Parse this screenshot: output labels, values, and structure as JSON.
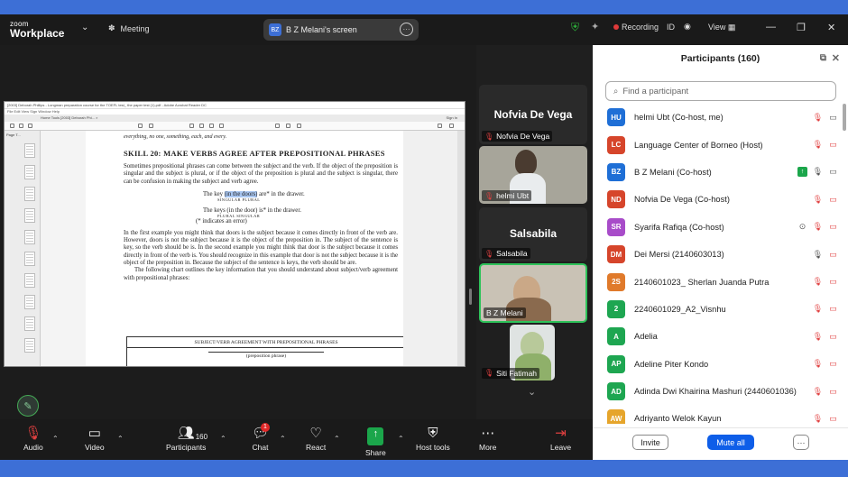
{
  "app": {
    "brand_line1": "zoom",
    "brand_line2": "Workplace",
    "meeting_label": "Meeting"
  },
  "screen_share": {
    "initials": "BZ",
    "label": "B Z Melani's screen"
  },
  "titlebar": {
    "recording_label": "Recording",
    "id_label": "ID",
    "view_label": "View"
  },
  "pdf": {
    "window_title": "[2003] Deborah Phillips - Longman preparation course for the TOEFL test_ the paper test (1).pdf - Adobe Acrobat Reader DC",
    "menu": "File   Edit   View   Sign   Window   Help",
    "tabs": "Home    Tools    [2003] Deborah Phi...  ×",
    "signin": "Sign In",
    "page_label": "Page T...",
    "top_line": "everything, no one, something, each, and every.",
    "heading": "SKILL 20:  MAKE VERBS AGREE AFTER PREPOSITIONAL PHRASES",
    "para1": "Sometimes prepositional phrases can come between the subject and the verb. If the object of the preposition is singular and the subject is plural, or if the object of the preposition is plural and the subject is singular, there can be confusion in making the subject and verb agree.",
    "ex1_pre": "The key ",
    "ex1_hl": "(in the doors)",
    "ex1_post": " are* in the drawer.",
    "ex1_sub": "SINGULAR                 PLURAL",
    "ex2": "The keys (in the door) is* in the drawer.",
    "ex2_sub": "PLURAL                 SINGULAR",
    "ex_note": "(* indicates an error)",
    "para2": "In the first example you might think that doors is the subject because it comes directly in front of the verb are. However, doors is not the subject because it is the object of the preposition in. The subject of the sentence is key, so the verb should be is. In the second example you might think that door is the subject because it comes directly in front of the verb is. You should recognize in this example that door is not the subject because it is the object of the preposition in. Because the subject of the sentence is keys, the verb should be are.",
    "para3": "The following chart outlines the key information that you should understand about subject/verb agreement with prepositional phrases:",
    "table_header": "SUBJECT/VERB AGREEMENT WITH PREPOSITIONAL PHRASES",
    "table_row": "(preposition phrase)"
  },
  "video_tiles": [
    {
      "big_name": "Nofvia De Vega",
      "label": "Nofvia De Vega"
    },
    {
      "label": "helmi Ubt"
    },
    {
      "big_name": "Salsabila",
      "label": "Salsabila"
    },
    {
      "label": "B Z Melani"
    },
    {
      "label": "Siti Fatimah"
    }
  ],
  "panel": {
    "title": "Participants (160)",
    "search_placeholder": "Find a participant",
    "invite": "Invite",
    "mute_all": "Mute all",
    "more": "···"
  },
  "participants": [
    {
      "initials": "HU",
      "name": "helmi Ubt (Co-host, me)",
      "color": "#1f6fd6"
    },
    {
      "initials": "LC",
      "name": "Language Center of Borneo (Host)",
      "color": "#d6452b"
    },
    {
      "initials": "BZ",
      "name": "B Z Melani (Co-host)",
      "color": "#1f6fd6"
    },
    {
      "initials": "ND",
      "name": "Nofvia De Vega (Co-host)",
      "color": "#d6452b"
    },
    {
      "initials": "SR",
      "name": "Syarifa Rafiqa (Co-host)",
      "color": "#a84cc9"
    },
    {
      "initials": "DM",
      "name": "Dei Mersi (2140603013)",
      "color": "#d6452b"
    },
    {
      "initials": "2S",
      "name": "2140601023_ Sherlan Juanda Putra",
      "color": "#e07a2b"
    },
    {
      "initials": "2",
      "name": "2240601029_A2_Visnhu",
      "color": "#1ea651"
    },
    {
      "initials": "A",
      "name": "Adelia",
      "color": "#1ea651"
    },
    {
      "initials": "AP",
      "name": "Adeline Piter Kondo",
      "color": "#1ea651"
    },
    {
      "initials": "AD",
      "name": "Adinda Dwi Khairina Mashuri (2440601036)",
      "color": "#1ea651"
    },
    {
      "initials": "AW",
      "name": "Adriyanto Welok Kayun",
      "color": "#e6a52b"
    }
  ],
  "toolbar": {
    "audio": "Audio",
    "video": "Video",
    "participants": "Participants",
    "participants_count": "160",
    "chat": "Chat",
    "chat_badge": "1",
    "react": "React",
    "share": "Share",
    "host_tools": "Host tools",
    "more": "More",
    "leave": "Leave"
  }
}
